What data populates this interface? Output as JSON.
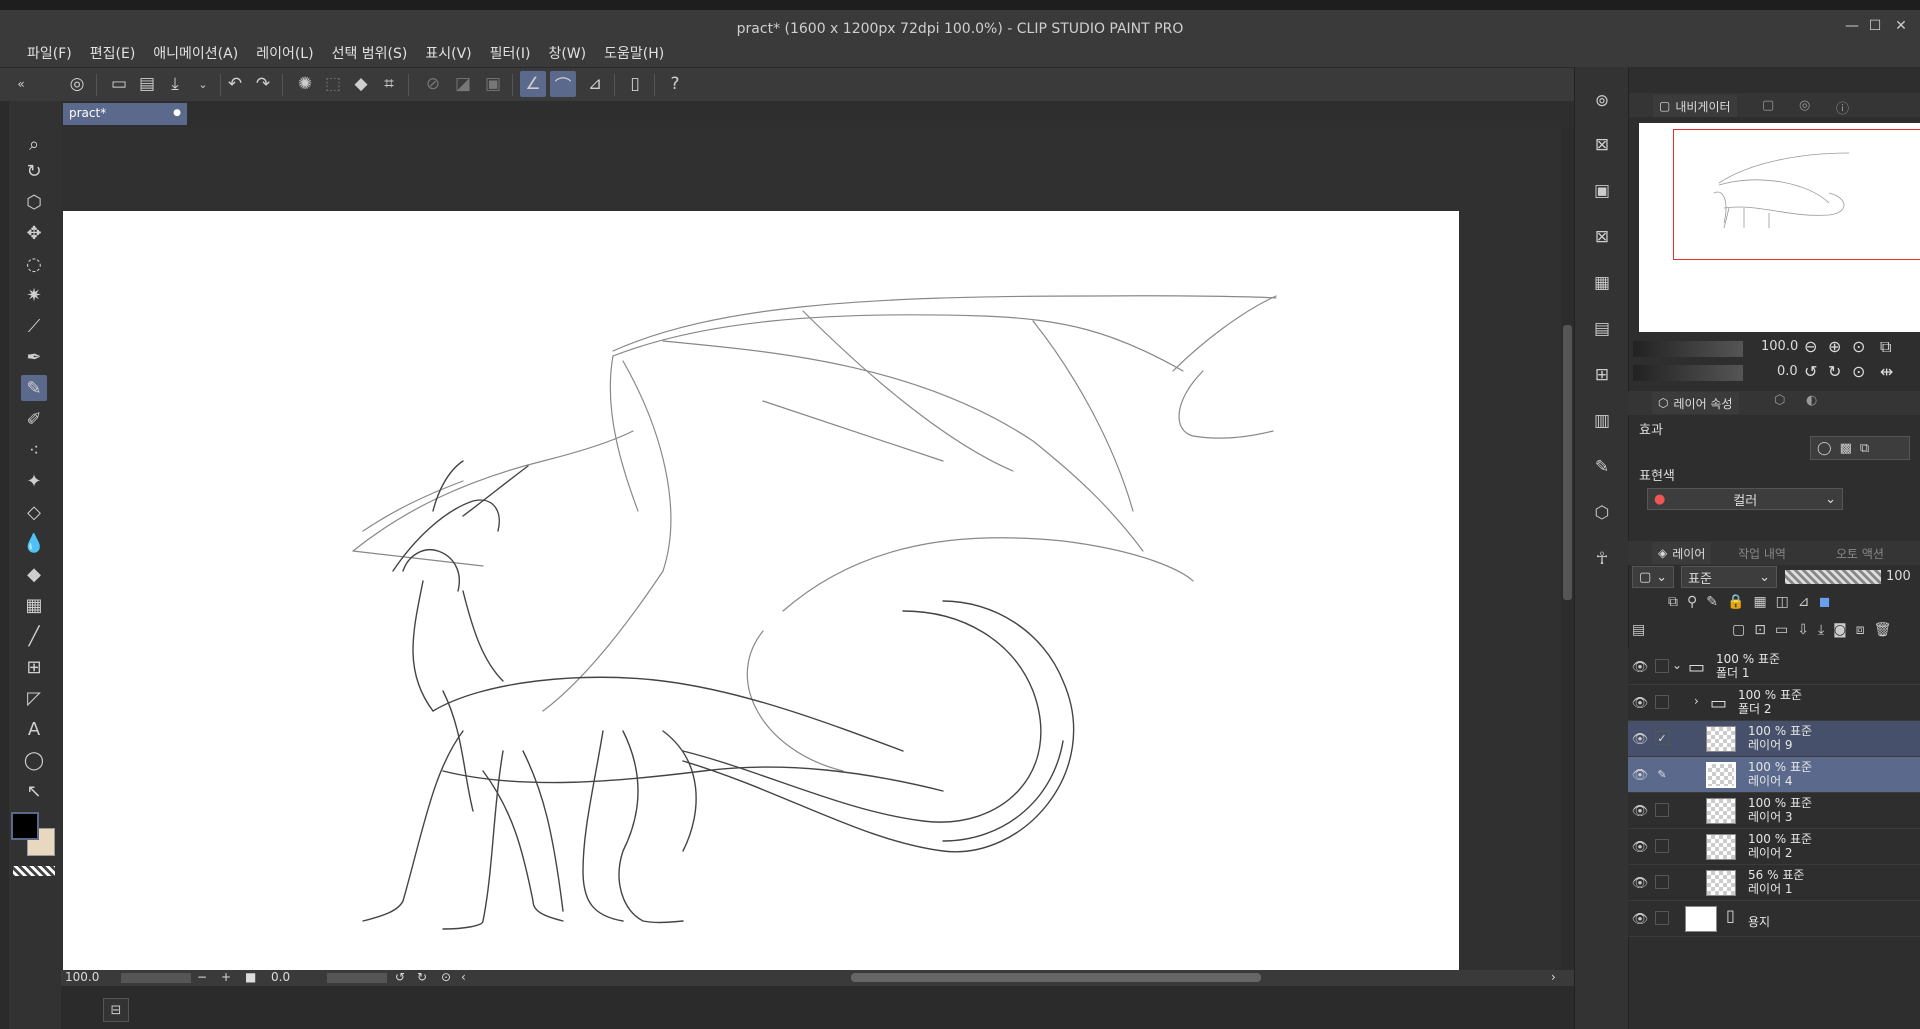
{
  "window": {
    "title": "pract* (1600 x 1200px 72dpi 100.0%)  - CLIP STUDIO PAINT PRO"
  },
  "menu": [
    "파일(F)",
    "편집(E)",
    "애니메이션(A)",
    "레이어(L)",
    "선택 범위(S)",
    "표시(V)",
    "필터(I)",
    "창(W)",
    "도움말(H)"
  ],
  "document_tab": {
    "label": "pract*",
    "dot": "●"
  },
  "status": {
    "zoom": "100.0",
    "rotation": "0.0",
    "minus": "−",
    "plus": "+"
  },
  "navigator": {
    "tab_label": "내비게이터",
    "zoom_value": "100.0",
    "rotate_value": "0.0"
  },
  "layer_property": {
    "tab_label": "레이어 속성",
    "effect_label": "효과",
    "express_color_label": "표현색",
    "color_option": "컬러"
  },
  "layer_panel": {
    "tabs": [
      "레이어",
      "작업 내역",
      "오토 액션"
    ],
    "blend_mode": "표준",
    "opacity": "100"
  },
  "layers": [
    {
      "opacity": "100 %",
      "mode": "표준",
      "name": "폴더 1",
      "type": "folder-open"
    },
    {
      "opacity": "100 %",
      "mode": "표준",
      "name": "폴더 2",
      "type": "folder"
    },
    {
      "opacity": "100 %",
      "mode": "표준",
      "name": "레이어 9",
      "type": "raster"
    },
    {
      "opacity": "100 %",
      "mode": "표준",
      "name": "레이어 4",
      "type": "raster"
    },
    {
      "opacity": "100 %",
      "mode": "표준",
      "name": "레이어 3",
      "type": "raster"
    },
    {
      "opacity": "100 %",
      "mode": "표준",
      "name": "레이어 2",
      "type": "raster"
    },
    {
      "opacity": "56 %",
      "mode": "표준",
      "name": "레이어 1",
      "type": "raster"
    },
    {
      "name": "용지",
      "type": "paper"
    }
  ],
  "colors": {
    "main": "#000000",
    "sub": "#e8d8c0",
    "accent": "#5b6a8c"
  }
}
